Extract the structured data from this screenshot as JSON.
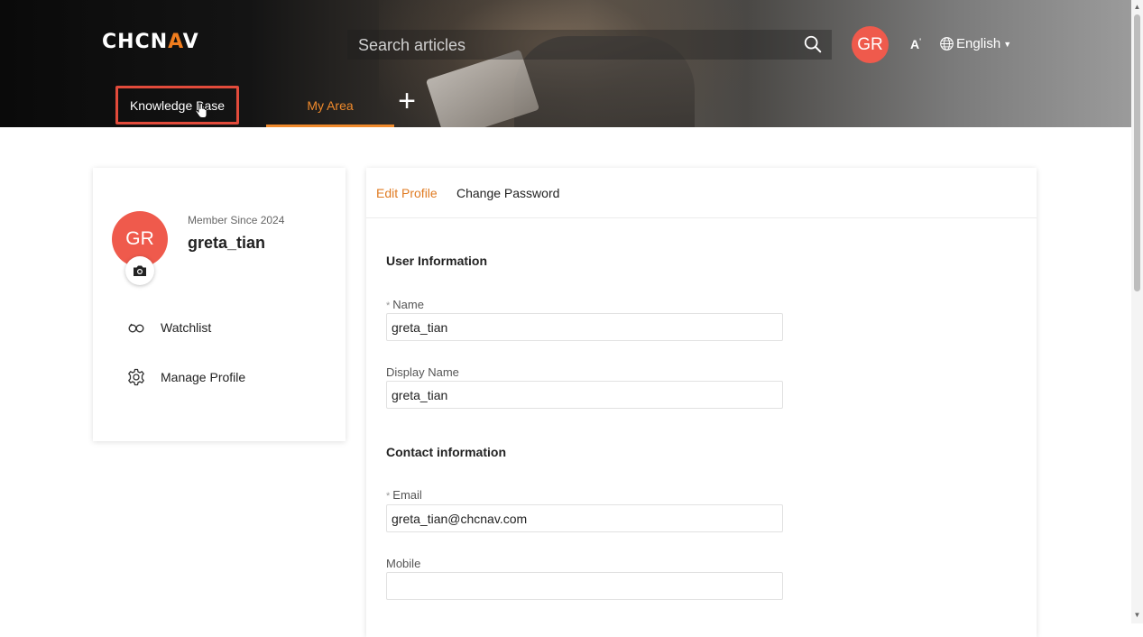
{
  "header": {
    "logo_prefix": "CHCN",
    "logo_accent": "A",
    "logo_suffix": "V",
    "search_placeholder": "Search articles",
    "avatar_initials": "GR",
    "font_size_label": "A",
    "language": "English"
  },
  "nav": {
    "knowledge_base": "Knowledge Base",
    "my_area": "My Area",
    "add": "+"
  },
  "profile": {
    "avatar_initials": "GR",
    "member_since": "Member Since 2024",
    "username": "greta_tian",
    "menu": {
      "watchlist": "Watchlist",
      "manage_profile": "Manage Profile"
    }
  },
  "form": {
    "tabs": {
      "edit_profile": "Edit Profile",
      "change_password": "Change Password"
    },
    "user_information_title": "User Information",
    "contact_information_title": "Contact information",
    "required_mark": "*",
    "fields": {
      "name": {
        "label": "Name",
        "value": "greta_tian"
      },
      "display_name": {
        "label": "Display Name",
        "value": "greta_tian"
      },
      "email": {
        "label": "Email",
        "value": "greta_tian@chcnav.com"
      },
      "mobile": {
        "label": "Mobile",
        "value": ""
      }
    }
  },
  "colors": {
    "accent_orange": "#f08a2c",
    "avatar_red": "#ef5a4c",
    "highlight_red": "#e24b3b"
  },
  "icons": {
    "search": "search-icon",
    "globe": "globe-icon",
    "camera": "camera-icon",
    "watchlist": "glasses-icon",
    "manage_profile": "gear-icon"
  }
}
